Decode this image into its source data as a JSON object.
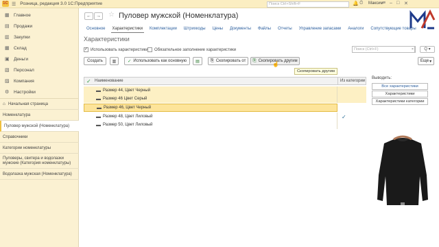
{
  "titlebar": {
    "menu_icon": "hamburger-icon",
    "app_title": "Розница, редакция 3.0  1С:Предприятие",
    "search_placeholder": "Поиск Ctrl+Shift+F",
    "user": "Максим"
  },
  "sidebar": {
    "items": [
      {
        "label": "Главное",
        "icon": "home-grid-icon"
      },
      {
        "label": "Продажи",
        "icon": "sales-icon"
      },
      {
        "label": "Закупки",
        "icon": "purchases-icon"
      },
      {
        "label": "Склад",
        "icon": "warehouse-icon"
      },
      {
        "label": "Деньги",
        "icon": "money-icon"
      },
      {
        "label": "Персонал",
        "icon": "personnel-icon"
      },
      {
        "label": "Компания",
        "icon": "company-icon"
      },
      {
        "label": "Настройки",
        "icon": "settings-icon"
      }
    ],
    "open_windows": [
      {
        "label": "Начальная страница"
      },
      {
        "label": "Номенклатура"
      },
      {
        "label": "Пуловер мужской (Номенклатура)"
      },
      {
        "label": "Справочники"
      },
      {
        "label": "Категории номенклатуры"
      },
      {
        "label": "Пуловеры, свитера и водолазки мужские (Категория номенклатуры)"
      },
      {
        "label": "Водолазка мужская (Номенклатура)"
      }
    ]
  },
  "header": {
    "back": "←",
    "forward": "→",
    "title": "Пуловер мужской (Номенклатура)"
  },
  "tabs": [
    {
      "label": "Основное"
    },
    {
      "label": "Характеристики"
    },
    {
      "label": "Комплектации"
    },
    {
      "label": "Штрихкоды"
    },
    {
      "label": "Цены"
    },
    {
      "label": "Документы"
    },
    {
      "label": "Файлы"
    },
    {
      "label": "Отчеты"
    },
    {
      "label": "Управление запасами"
    },
    {
      "label": "Аналоги"
    },
    {
      "label": "Сопутствующие товары"
    }
  ],
  "section": {
    "title": "Характеристики",
    "use_characteristics": "Использовать характеристики",
    "required_fill": "Обязательное заполнение характеристики",
    "search_placeholder": "Поиск (Ctrl+F)",
    "find_button": "Q"
  },
  "toolbar": {
    "create": "Создать",
    "use_as_main": "Использовать как основную",
    "copy_from": "Скопировать от",
    "copy_to_others": "Скопировать другим",
    "more": "Еще",
    "tooltip": "Скопировать другим"
  },
  "grid": {
    "col_name": "Наименование",
    "col_from_category": "Из категории",
    "rows": [
      {
        "name": "Размер 44, Цвет Черный",
        "from_category": false
      },
      {
        "name": "Размер 46 Цвет Серый",
        "from_category": false
      },
      {
        "name": "Размер 46, Цвет Черный",
        "from_category": false
      },
      {
        "name": "Размер 48, Цвет Лиловый",
        "from_category": true
      },
      {
        "name": "Размер 50, Цвет Лиловый",
        "from_category": false
      }
    ]
  },
  "right_panel": {
    "label": "Выводить:",
    "buttons": [
      {
        "label": "Все характеристики"
      },
      {
        "label": "Характеристики номенклатуры"
      },
      {
        "label": "Характеристики категории"
      }
    ]
  },
  "colors": {
    "sidebar_bg": "#fbf1d2",
    "selected_row": "#fde49a",
    "link": "#2c5f9e",
    "accent": "#f0c040"
  }
}
